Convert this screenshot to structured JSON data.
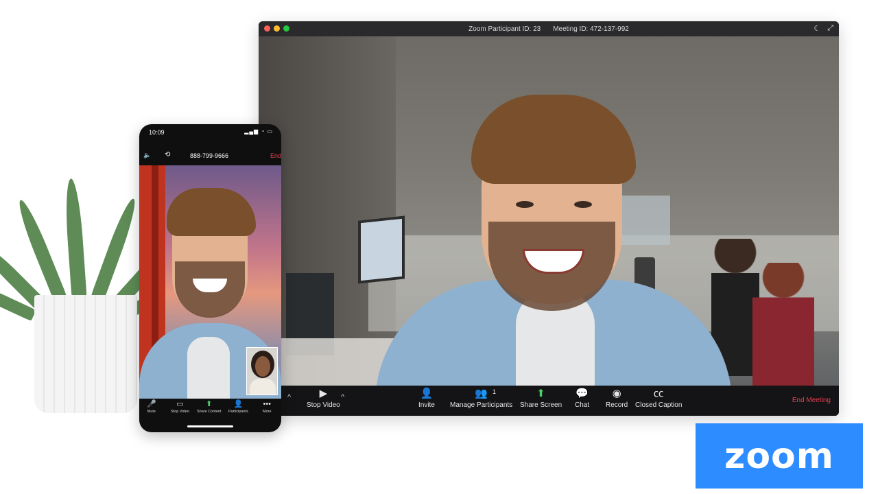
{
  "desktop": {
    "title_participant": "Zoom Participant ID: 23",
    "title_meeting": "Meeting ID: 472-137-992",
    "toolbar": {
      "stop_video": "Stop Video",
      "invite": "Invite",
      "manage_participants": "Manage Participants",
      "participant_count": "1",
      "share_screen": "Share Screen",
      "chat": "Chat",
      "record": "Record",
      "closed_caption": "Closed Caption",
      "end_meeting": "End Meeting"
    }
  },
  "phone": {
    "time": "10:09",
    "phone_number": "888-799-9666",
    "end": "End",
    "toolbar": {
      "mute": "Mute",
      "stop_video": "Stop Video",
      "share_content": "Share Content",
      "participants": "Participants",
      "more": "More"
    }
  },
  "brand": {
    "logo_text": "zoom",
    "color": "#2d8cff"
  },
  "colors": {
    "end_red": "#e5404f",
    "share_green": "#4ed06a"
  }
}
